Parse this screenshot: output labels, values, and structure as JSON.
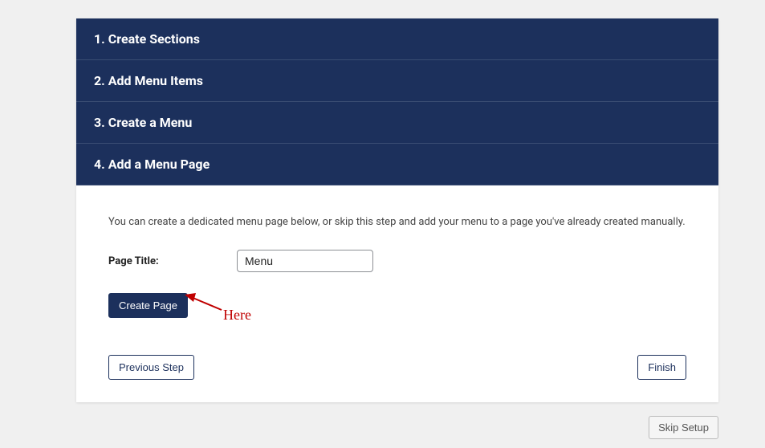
{
  "steps": [
    {
      "label": "1. Create Sections"
    },
    {
      "label": "2. Add Menu Items"
    },
    {
      "label": "3. Create a Menu"
    },
    {
      "label": "4. Add a Menu Page"
    }
  ],
  "body": {
    "description": "You can create a dedicated menu page below, or skip this step and add your menu to a page you've already created manually.",
    "page_title_label": "Page Title:",
    "page_title_value": "Menu",
    "create_page_label": "Create Page",
    "previous_step_label": "Previous Step",
    "finish_label": "Finish"
  },
  "skip_setup_label": "Skip Setup",
  "annotation": {
    "text": "Here"
  }
}
